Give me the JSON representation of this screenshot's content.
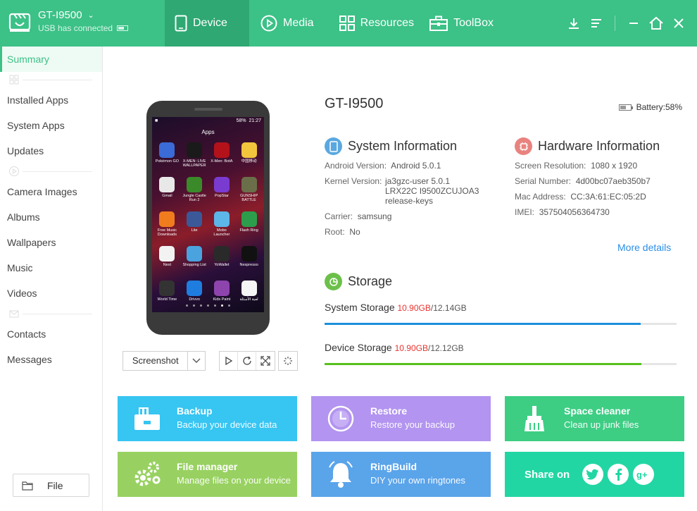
{
  "header": {
    "device_name": "GT-I9500",
    "connection_status": "USB has connected",
    "tabs": [
      {
        "label": "Device",
        "icon": "phone-icon"
      },
      {
        "label": "Media",
        "icon": "play-circle-icon"
      },
      {
        "label": "Resources",
        "icon": "grid-icon"
      },
      {
        "label": "ToolBox",
        "icon": "toolbox-icon"
      }
    ],
    "window_controls": [
      "download-icon",
      "menu-icon",
      "minimize-icon",
      "home-icon",
      "close-icon"
    ]
  },
  "sidebar": {
    "items": [
      {
        "label": "Summary",
        "active": true
      },
      {
        "label": "Installed Apps"
      },
      {
        "label": "System Apps"
      },
      {
        "label": "Updates"
      },
      {
        "label": "Camera Images"
      },
      {
        "label": "Albums"
      },
      {
        "label": "Wallpapers"
      },
      {
        "label": "Music"
      },
      {
        "label": "Videos"
      },
      {
        "label": "Contacts"
      },
      {
        "label": "Messages"
      }
    ],
    "file_button": "File"
  },
  "phone": {
    "status_time": "21:27",
    "status_battery": "58%",
    "screen_title": "Apps",
    "apps": [
      {
        "label": "Pokémon GO",
        "color": "#3b6bd6"
      },
      {
        "label": "X-MEN: LIVE WALLPAPER",
        "color": "#1a1a1a"
      },
      {
        "label": "X-Men: BotA",
        "color": "#b3121b"
      },
      {
        "label": "中国移动",
        "color": "#f2c53d"
      },
      {
        "label": "Gmail",
        "color": "#e8e8e8"
      },
      {
        "label": "Jungle Castle Run 2",
        "color": "#3b8a2a"
      },
      {
        "label": "PopStar",
        "color": "#7a3bd1"
      },
      {
        "label": "GUNSHIP BATTLE",
        "color": "#6a6f4a"
      },
      {
        "label": "Free Music Downloads",
        "color": "#f07c1e"
      },
      {
        "label": "Lite",
        "color": "#3b5998"
      },
      {
        "label": "Mobo Launcher",
        "color": "#5cb6e8"
      },
      {
        "label": "Flash Ring",
        "color": "#2c9e4b"
      },
      {
        "label": "Next",
        "color": "#f2f2f2"
      },
      {
        "label": "Shopping List",
        "color": "#4aa3df"
      },
      {
        "label": "YoWallet",
        "color": "#2a2a2a"
      },
      {
        "label": "Nespresso",
        "color": "#111111"
      },
      {
        "label": "World Time",
        "color": "#333333"
      },
      {
        "label": "Drivvo",
        "color": "#1f7de0"
      },
      {
        "label": "Kids Paint",
        "color": "#8e44ad"
      },
      {
        "label": "لعبة الأسئلة",
        "color": "#f5f5f5"
      }
    ]
  },
  "phone_controls": {
    "screenshot_label": "Screenshot"
  },
  "device_info": {
    "model": "GT-I9500",
    "battery": "Battery:58%",
    "system_title": "System Information",
    "system": {
      "android_key": "Android Version:",
      "android_val": "Android 5.0.1",
      "kernel_key": "Kernel Version:",
      "kernel_val_1": "ja3gzc-user 5.0.1",
      "kernel_val_2": "LRX22C I9500ZCUJOA3",
      "kernel_val_3": "release-keys",
      "carrier_key": "Carrier:",
      "carrier_val": "samsung",
      "root_key": "Root:",
      "root_val": "No"
    },
    "hardware_title": "Hardware Information",
    "hardware": {
      "res_key": "Screen Resolution:",
      "res_val": "1080 x 1920",
      "serial_key": "Serial Number:",
      "serial_val": "4d00bc07aeb350b7",
      "mac_key": "Mac Address:",
      "mac_val": "CC:3A:61:EC:05:2D",
      "imei_key": "IMEI:",
      "imei_val": "357504056364730"
    },
    "more_details": "More details"
  },
  "storage": {
    "title": "Storage",
    "system": {
      "label": "System Storage",
      "used": "10.90GB",
      "total": "/12.14GB",
      "fraction": 0.898,
      "color": "#1e8fdc"
    },
    "device": {
      "label": "Device Storage",
      "used": "10.90GB",
      "total": "/12.12GB",
      "fraction": 0.899,
      "color": "#57c11c"
    }
  },
  "tiles": [
    {
      "title": "Backup",
      "subtitle": "Backup your device data",
      "color": "#37c5f2",
      "icon": "backup-icon"
    },
    {
      "title": "Restore",
      "subtitle": "Restore your backup",
      "color": "#b394f0",
      "icon": "clock-icon"
    },
    {
      "title": "Space cleaner",
      "subtitle": "Clean up junk files",
      "color": "#3dce84",
      "icon": "broom-icon"
    },
    {
      "title": "File manager",
      "subtitle": "Manage files on your device",
      "color": "#98d161",
      "icon": "gears-icon"
    },
    {
      "title": "RingBuild",
      "subtitle": "DIY your own ringtones",
      "color": "#5aa4ea",
      "icon": "bell-icon"
    },
    {
      "title": "Share on",
      "color": "#22d6a4",
      "social": [
        "twitter-icon",
        "facebook-icon",
        "google-plus-icon"
      ]
    }
  ]
}
